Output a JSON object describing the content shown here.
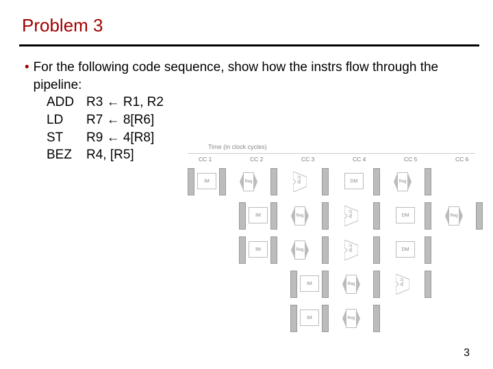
{
  "title": "Problem 3",
  "bullet_text": "For the following code sequence, show how the instrs flow through the pipeline:",
  "arrow": "←",
  "code": [
    {
      "op": "ADD",
      "args_pre": "R3 ",
      "args_post": " R1, R2"
    },
    {
      "op": "LD",
      "args_pre": "R7 ",
      "args_post": " 8[R6]"
    },
    {
      "op": "ST",
      "args_pre": "R9 ",
      "args_post": " 4[R8]"
    },
    {
      "op": "BEZ",
      "args_pre": "R4, [R5]",
      "args_post": ""
    }
  ],
  "diagram": {
    "caption": "Time (in clock cycles)",
    "cc": [
      "CC 1",
      "CC 2",
      "CC 3",
      "CC 4",
      "CC 5",
      "CC 6"
    ],
    "stages": {
      "im": "IM",
      "reg": "Reg",
      "alu": "ALU",
      "dm": "DM"
    }
  },
  "page_number": "3"
}
